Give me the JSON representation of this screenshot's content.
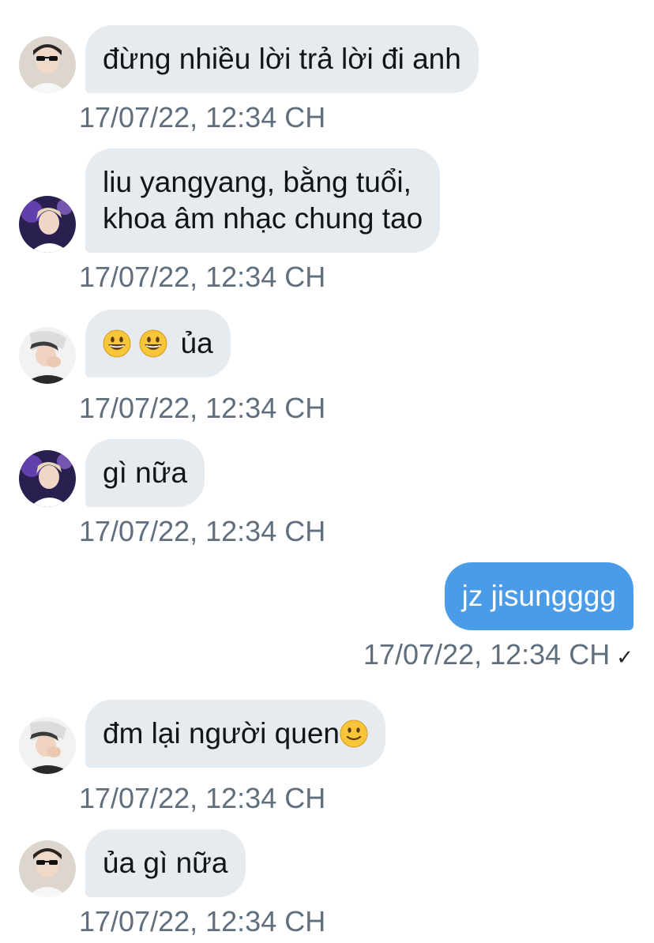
{
  "messages": [
    {
      "text": "đừng nhiều lời trả lời đi anh",
      "time": "17/07/22, 12:34 CH",
      "avatar": "avatar-sunglasses"
    },
    {
      "line1": "liu yangyang, bằng tuổi,",
      "line2": "khoa âm nhạc chung tao",
      "time": "17/07/22, 12:34 CH",
      "avatar": "avatar-purple-stage"
    },
    {
      "text": "ủa",
      "emoji": [
        "grinning-face-icon",
        "grinning-face-icon"
      ],
      "time": "17/07/22, 12:34 CH",
      "avatar": "avatar-hand-face"
    },
    {
      "text": "gì nữa",
      "time": "17/07/22, 12:34 CH",
      "avatar": "avatar-purple-stage"
    },
    {
      "text": "jz jisungggg",
      "time": "17/07/22, 12:34 CH",
      "status": "✓",
      "outgoing": true
    },
    {
      "text": "đm lại người quen",
      "emoji": [
        "slightly-smiling-face-icon"
      ],
      "time": "17/07/22, 12:34 CH",
      "avatar": "avatar-hand-face"
    },
    {
      "text": "ủa gì nữa",
      "time": "17/07/22, 12:34 CH",
      "avatar": "avatar-sunglasses"
    }
  ],
  "colors": {
    "incoming_bubble": "#e6ebef",
    "outgoing_bubble": "#4a9ce8",
    "timestamp": "#5f6f7e"
  }
}
